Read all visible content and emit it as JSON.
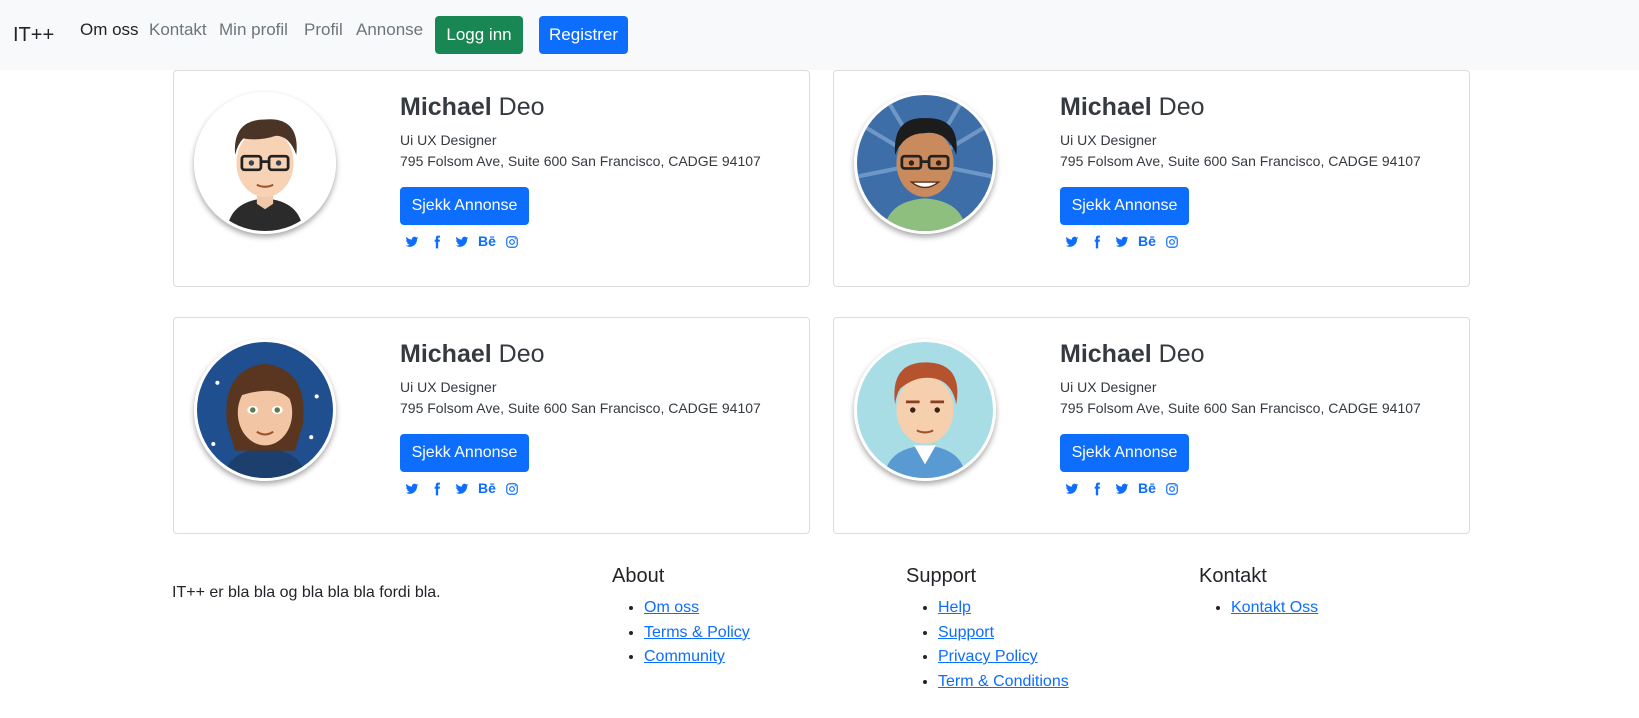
{
  "navbar": {
    "brand": "IT++",
    "links": [
      "Om oss",
      "Kontakt",
      "Min profil",
      "Profil",
      "Annonse"
    ],
    "login": "Logg inn",
    "register": "Registrer"
  },
  "cards": [
    {
      "first": "Michael",
      "last": "Deo",
      "role": "Ui UX Designer",
      "address": "795 Folsom Ave, Suite 600 San Francisco, CADGE 94107",
      "button": "Sjekk Annonse"
    },
    {
      "first": "Michael",
      "last": "Deo",
      "role": "Ui UX Designer",
      "address": "795 Folsom Ave, Suite 600 San Francisco, CADGE 94107",
      "button": "Sjekk Annonse"
    },
    {
      "first": "Michael",
      "last": "Deo",
      "role": "Ui UX Designer",
      "address": "795 Folsom Ave, Suite 600 San Francisco, CADGE 94107",
      "button": "Sjekk Annonse"
    },
    {
      "first": "Michael",
      "last": "Deo",
      "role": "Ui UX Designer",
      "address": "795 Folsom Ave, Suite 600 San Francisco, CADGE 94107",
      "button": "Sjekk Annonse"
    }
  ],
  "social_icons": [
    "twitter-icon",
    "facebook-icon",
    "twitter-icon",
    "behance-icon",
    "instagram-icon"
  ],
  "behance_text": "Bē",
  "footer": {
    "about_text": "IT++ er bla bla og bla bla bla fordi bla.",
    "about": {
      "title": "About",
      "links": [
        "Om oss",
        "Terms & Policy",
        "Community"
      ]
    },
    "support": {
      "title": "Support",
      "links": [
        "Help",
        "Support",
        "Privacy Policy",
        "Term & Conditions"
      ]
    },
    "contact": {
      "title": "Kontakt",
      "links": [
        "Kontakt Oss"
      ]
    }
  },
  "colors": {
    "primary": "#0d6efd",
    "success": "#198754",
    "navbar_bg": "#f8f9fa"
  }
}
